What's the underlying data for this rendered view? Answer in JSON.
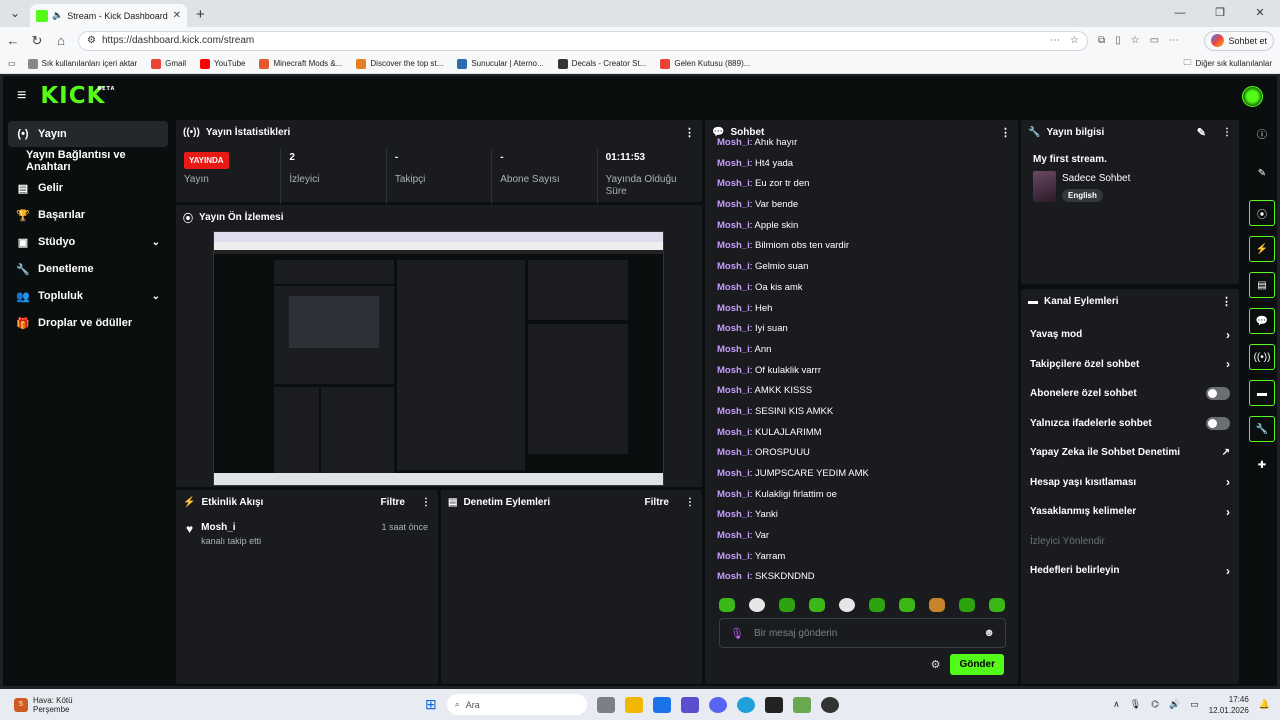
{
  "browser": {
    "tab_title": "Stream - Kick Dashboard",
    "url": "https://dashboard.kick.com/stream",
    "copilot_label": "Sohbet et",
    "bookmarks": [
      {
        "label": "Sık kullanılanları içeri aktar",
        "color": "#888888"
      },
      {
        "label": "Gmail",
        "color": "#ea4335"
      },
      {
        "label": "YouTube",
        "color": "#ff0000"
      },
      {
        "label": "Minecraft Mods &...",
        "color": "#e4572e"
      },
      {
        "label": "Discover the top st...",
        "color": "#e67e22"
      },
      {
        "label": "Sunucular | Aterno...",
        "color": "#2b6cb0"
      },
      {
        "label": "Decals - Creator St...",
        "color": "#333333"
      },
      {
        "label": "Gelen Kutusu (889)...",
        "color": "#ea4335"
      }
    ],
    "other_bookmarks": "Diğer sık kullanılanlar"
  },
  "app": {
    "logo": "KICK",
    "logo_badge": "BETA",
    "sidebar": [
      {
        "label": "Yayın",
        "icon": "stream-icon",
        "glyph": "(•)",
        "active": true
      },
      {
        "label": "Yayın Bağlantısı ve Anahtarı",
        "sub": true
      },
      {
        "label": "Gelir",
        "icon": "chart-icon",
        "glyph": "▤"
      },
      {
        "label": "Başarılar",
        "icon": "trophy-icon",
        "glyph": "🏆"
      },
      {
        "label": "Stüdyo",
        "icon": "studio-icon",
        "glyph": "▣",
        "chevron": true
      },
      {
        "label": "Denetleme",
        "icon": "wrench-icon",
        "glyph": "🔧"
      },
      {
        "label": "Topluluk",
        "icon": "community-icon",
        "glyph": "👥",
        "chevron": true
      },
      {
        "label": "Droplar ve ödüller",
        "icon": "gift-icon",
        "glyph": "🎁"
      }
    ],
    "stats_panel": {
      "title": "Yayın İstatistikleri",
      "live_badge": "YAYINDA",
      "items": [
        {
          "value": "",
          "label": "Yayın"
        },
        {
          "value": "2",
          "label": "İzleyici"
        },
        {
          "value": "-",
          "label": "Takipçi"
        },
        {
          "value": "-",
          "label": "Abone Sayısı"
        },
        {
          "value": "01:11:53",
          "label": "Yayında Olduğu Süre"
        }
      ]
    },
    "preview_panel": {
      "title": "Yayın Ön İzlemesi"
    },
    "activity_panel": {
      "title": "Etkinlik Akışı",
      "filter": "Filtre",
      "items": [
        {
          "user": "Mosh_i",
          "action": "kanalı takip etti",
          "time": "1 saat önce"
        }
      ]
    },
    "moderation_panel": {
      "title": "Denetim Eylemleri",
      "filter": "Filtre"
    },
    "chat": {
      "title": "Sohbet",
      "messages": [
        {
          "user": "Mosh_i",
          "text": "Ahık hayır"
        },
        {
          "user": "Mosh_i",
          "text": "Ht4 yada"
        },
        {
          "user": "Mosh_i",
          "text": "Eu zor tr den"
        },
        {
          "user": "Mosh_i",
          "text": "Var bende"
        },
        {
          "user": "Mosh_i",
          "text": "Apple skin"
        },
        {
          "user": "Mosh_i",
          "text": "Bilmiom obs ten vardir"
        },
        {
          "user": "Mosh_i",
          "text": "Gelmio suan"
        },
        {
          "user": "Mosh_i",
          "text": "Oa kis amk"
        },
        {
          "user": "Mosh_i",
          "text": "Heh"
        },
        {
          "user": "Mosh_i",
          "text": "Iyi suan"
        },
        {
          "user": "Mosh_i",
          "text": "Ann"
        },
        {
          "user": "Mosh_i",
          "text": "Of kulaklik varrr"
        },
        {
          "user": "Mosh_i",
          "text": "AMKK KISSS"
        },
        {
          "user": "Mosh_i",
          "text": "SESINI KIS AMKK"
        },
        {
          "user": "Mosh_i",
          "text": "KULAJLARIMM"
        },
        {
          "user": "Mosh_i",
          "text": "OROSPUUU"
        },
        {
          "user": "Mosh_i",
          "text": "JUMPSCARE YEDIM AMK"
        },
        {
          "user": "Mosh_i",
          "text": "Kulakligi firlattim oe"
        },
        {
          "user": "Mosh_i",
          "text": "Yanki"
        },
        {
          "user": "Mosh_i",
          "text": "Var"
        },
        {
          "user": "Mosh_i",
          "text": "Yarram"
        },
        {
          "user": "Mosh_i",
          "text": "SKSKDNDND"
        }
      ],
      "input_placeholder": "Bir mesaj gönderin",
      "send_label": "Gönder"
    },
    "stream_info": {
      "title": "Yayın bilgisi",
      "stream_title": "My first stream.",
      "category": "Sadece Sohbet",
      "language_tag": "English"
    },
    "channel_actions": {
      "title": "Kanal Eylemleri",
      "items": [
        {
          "label": "Yavaş mod",
          "type": "chevron"
        },
        {
          "label": "Takipçilere özel sohbet",
          "type": "chevron"
        },
        {
          "label": "Abonelere özel sohbet",
          "type": "toggle",
          "on": false
        },
        {
          "label": "Yalnızca ifadelerle sohbet",
          "type": "toggle",
          "on": false
        },
        {
          "label": "Yapay Zeka ile Sohbet Denetimi",
          "type": "external"
        },
        {
          "label": "Hesap yaşı kısıtlaması",
          "type": "chevron"
        },
        {
          "label": "Yasaklanmış kelimeler",
          "type": "chevron"
        },
        {
          "label": "İzleyici Yönlendir",
          "type": "disabled"
        },
        {
          "label": "Hedefleri belirleyin",
          "type": "chevron"
        }
      ]
    }
  },
  "taskbar": {
    "weather": "Hava: Kötü",
    "weather_day": "Perşembe",
    "weather_badge": "5",
    "search_placeholder": "Ara",
    "time": "17:46",
    "date": "12.01.2026"
  }
}
